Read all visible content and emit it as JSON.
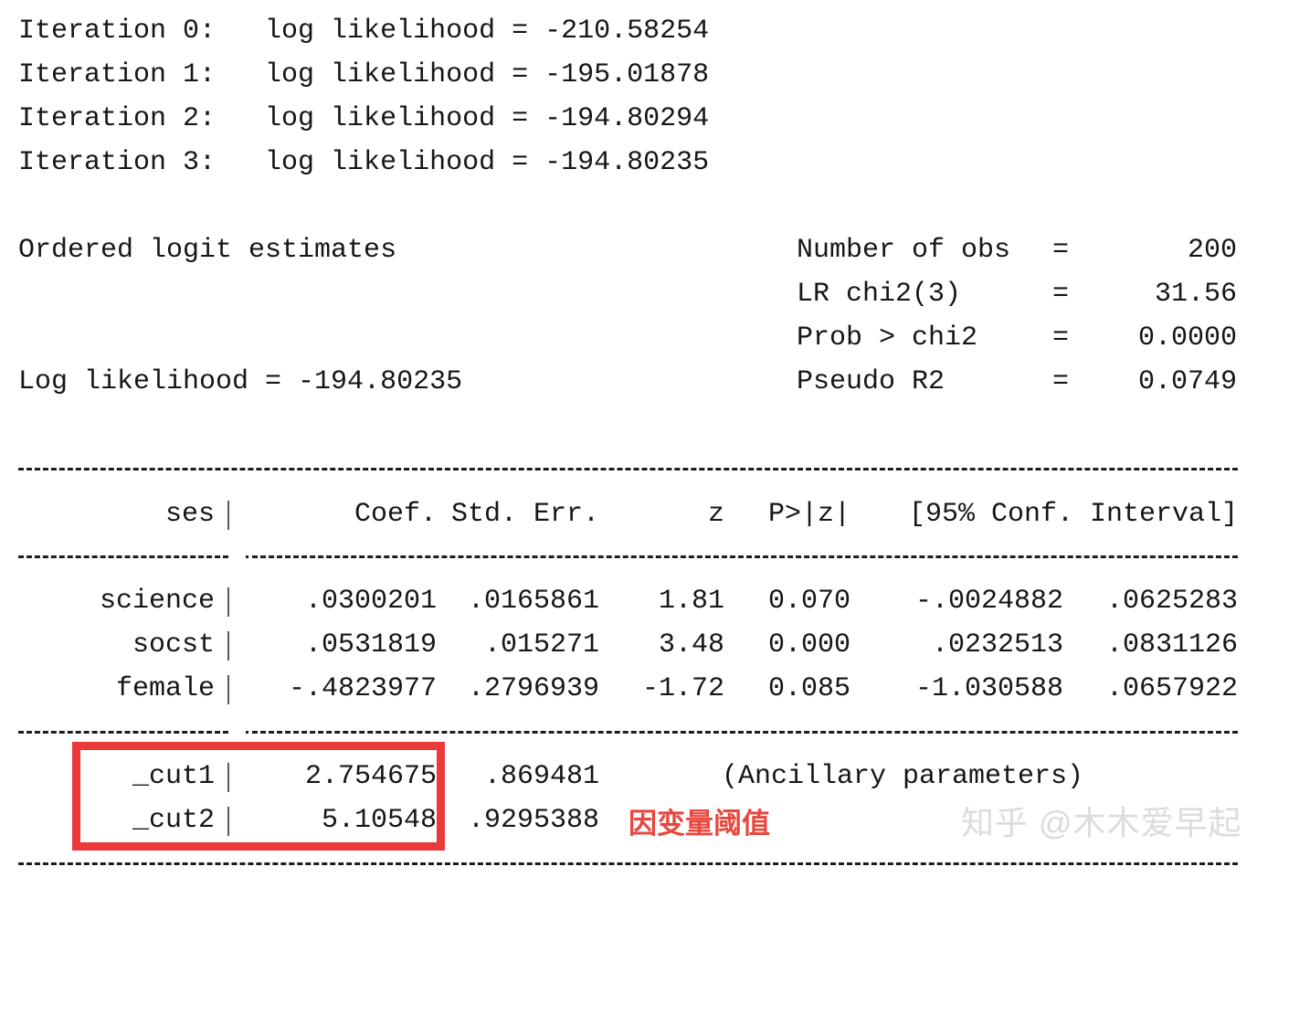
{
  "iterations": [
    "Iteration 0:   log likelihood = -210.58254",
    "Iteration 1:   log likelihood = -195.01878",
    "Iteration 2:   log likelihood = -194.80294",
    "Iteration 3:   log likelihood = -194.80235"
  ],
  "model": {
    "title": "Ordered logit estimates",
    "log_likelihood_line": "Log likelihood = -194.80235",
    "stats": [
      {
        "label": "Number of obs",
        "eq": "=",
        "value": "200"
      },
      {
        "label": "LR chi2(3)",
        "eq": "=",
        "value": "31.56"
      },
      {
        "label": "Prob > chi2",
        "eq": "=",
        "value": "0.0000"
      },
      {
        "label": "Pseudo R2",
        "eq": "=",
        "value": "0.0749"
      }
    ]
  },
  "table": {
    "headers": {
      "name": "ses",
      "coef": "Coef.",
      "se": "Std. Err.",
      "z": "z",
      "p": "P>|z|",
      "ci": "[95% Conf. Interval]"
    },
    "rows": [
      {
        "name": "science",
        "coef": ".0300201",
        "se": ".0165861",
        "z": "1.81",
        "p": "0.070",
        "ci_low": "-.0024882",
        "ci_high": ".0625283"
      },
      {
        "name": "socst",
        "coef": ".0531819",
        "se": ".015271",
        "z": "3.48",
        "p": "0.000",
        "ci_low": ".0232513",
        "ci_high": ".0831126"
      },
      {
        "name": "female",
        "coef": "-.4823977",
        "se": ".2796939",
        "z": "-1.72",
        "p": "0.085",
        "ci_low": "-1.030588",
        "ci_high": ".0657922"
      }
    ],
    "cutpoints": [
      {
        "name": "_cut1",
        "coef": "2.754675",
        "se": ".869481",
        "note": "(Ancillary parameters)"
      },
      {
        "name": "_cut2",
        "coef": "5.10548",
        "se": ".9295388",
        "note": ""
      }
    ]
  },
  "annotation": {
    "text": "因变量阈值",
    "color": "#e8473f"
  },
  "watermark": {
    "text": "知乎 @木木爱早起",
    "color": "#dcdcdc"
  }
}
